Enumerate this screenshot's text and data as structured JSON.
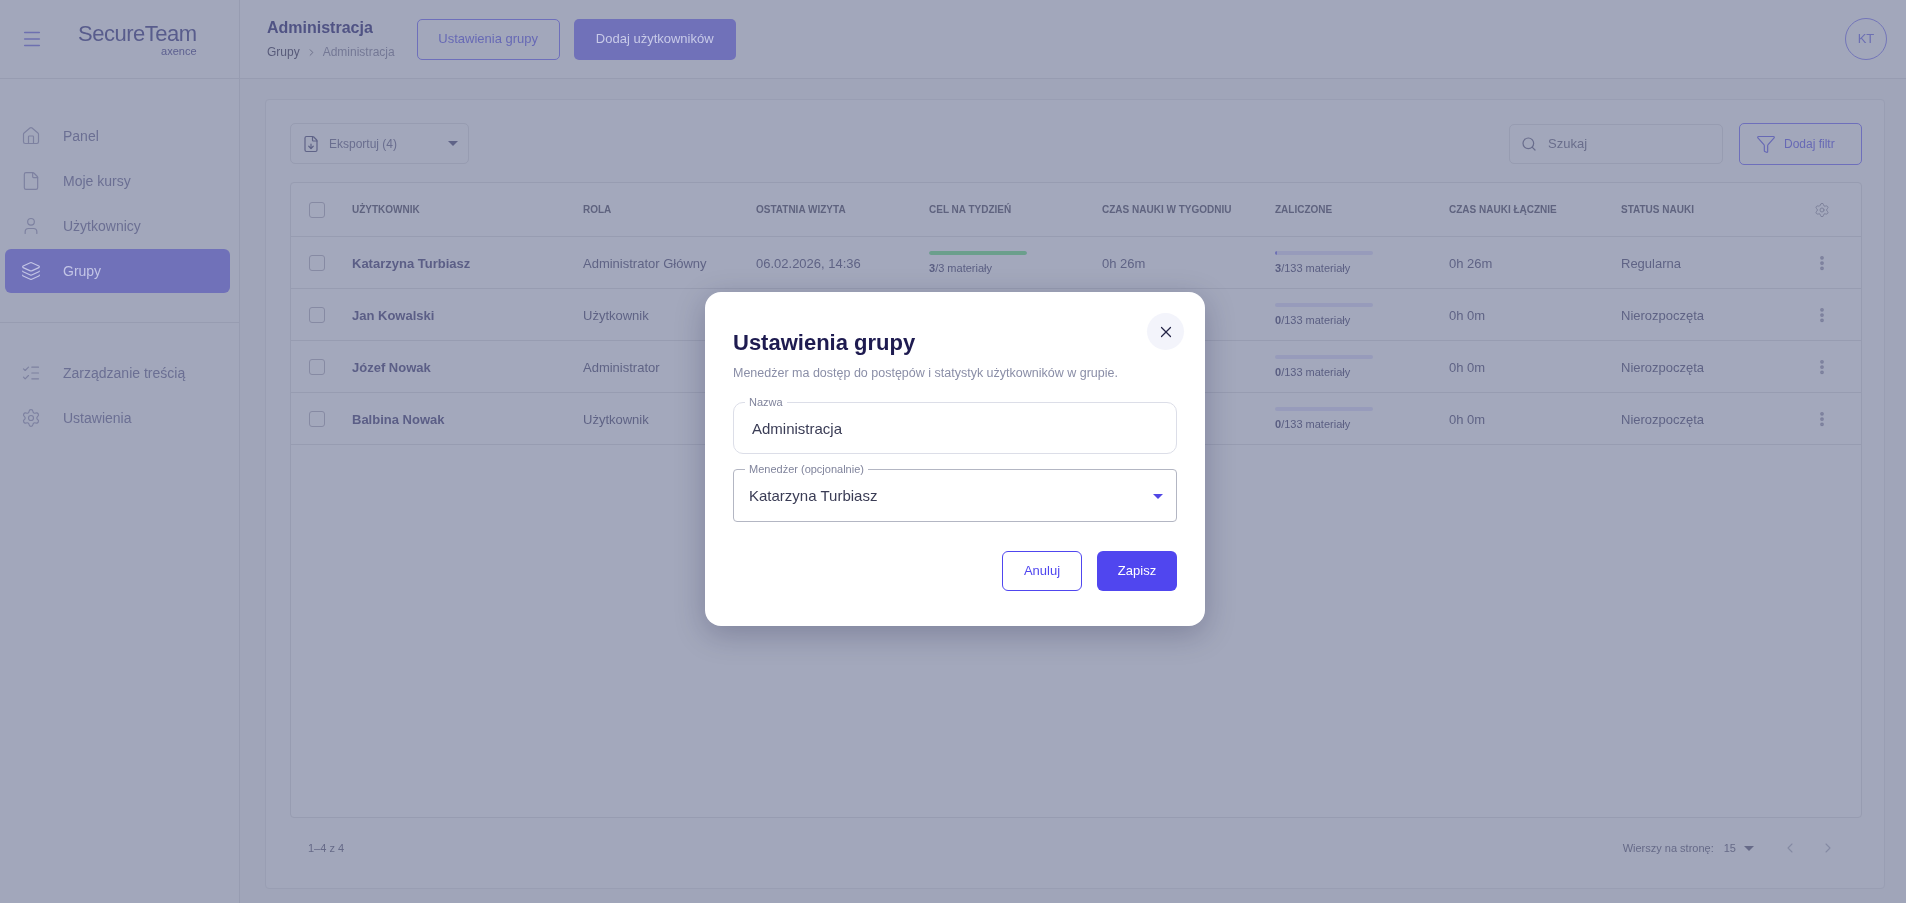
{
  "header": {
    "logo": {
      "name": "SecureTeam",
      "vendor": "axence"
    },
    "title": "Administracja",
    "breadcrumb": [
      {
        "label": "Grupy",
        "current": false
      },
      {
        "label": "Administracja",
        "current": true
      }
    ],
    "actions": [
      {
        "label": "Ustawienia grupy",
        "kind": "outline"
      },
      {
        "label": "Dodaj użytkowników",
        "kind": "filled"
      }
    ],
    "avatar": "KT"
  },
  "sidebar": {
    "sections": [
      {
        "items": [
          {
            "label": "Panel",
            "selected": false
          },
          {
            "label": "Moje kursy",
            "selected": false
          },
          {
            "label": "Użytkownicy",
            "selected": false
          },
          {
            "label": "Grupy",
            "selected": true
          }
        ]
      },
      {
        "items": [
          {
            "label": "Zarządzanie treścią",
            "selected": false
          },
          {
            "label": "Ustawienia",
            "selected": false
          }
        ]
      }
    ]
  },
  "toolbar": {
    "export": "Eksportuj (4)",
    "search": {
      "placeholder": "Szukaj"
    },
    "filter": "Dodaj filtr"
  },
  "table": {
    "all_checked": false,
    "columns": [
      "UŻYTKOWNIK",
      "ROLA",
      "OSTATNIA WIZYTA",
      "CEL NA TYDZIEŃ",
      "CZAS NAUKI W TYGODNIU",
      "ZALICZONE",
      "CZAS NAUKI ŁĄCZNIE",
      "STATUS NAUKI"
    ],
    "rows": [
      {
        "checked": false,
        "user": "Katarzyna Turbiasz",
        "role": "Administrator Główny",
        "last_visit": "06.02.2026, 14:36",
        "weekly_goal": {
          "level": 1,
          "text": "**3**/3 materiały"
        },
        "weekly_time": "0h 26m",
        "completed": {
          "level": 0.023,
          "text": "**3**/133 materiały"
        },
        "total_time": "0h 26m",
        "status": "Regularna"
      },
      {
        "checked": false,
        "user": "Jan Kowalski",
        "role": "Użytkownik",
        "completed": {
          "level": 0,
          "text": "**0**/133 materiały"
        },
        "total_time": "0h 0m",
        "status": "Nierozpoczęta"
      },
      {
        "checked": false,
        "user": "Józef Nowak",
        "role": "Administrator",
        "completed": {
          "level": 0,
          "text": "**0**/133 materiały"
        },
        "total_time": "0h 0m",
        "status": "Nierozpoczęta"
      },
      {
        "checked": false,
        "user": "Balbina Nowak",
        "role": "Użytkownik",
        "completed": {
          "level": 0,
          "text": "**0**/133 materiały"
        },
        "total_time": "0h 0m",
        "status": "Nierozpoczęta"
      }
    ]
  },
  "pagination": {
    "range": "1–4 z 4",
    "rows_per_page_label": "Wierszy na stronę:",
    "rows_per_page": "15"
  },
  "dialog": {
    "title": "Ustawienia grupy",
    "description": "Menedżer ma dostęp do postępów i statystyk użytkowników w grupie.",
    "fields": [
      {
        "kind": "text",
        "label": "Nazwa",
        "value": "Administracja"
      },
      {
        "kind": "select",
        "label": "Menedżer (opcjonalnie)",
        "value": "Katarzyna Turbiasz"
      }
    ],
    "buttons": [
      {
        "label": "Anuluj",
        "kind": "outline"
      },
      {
        "label": "Zapisz",
        "kind": "primary"
      }
    ]
  }
}
